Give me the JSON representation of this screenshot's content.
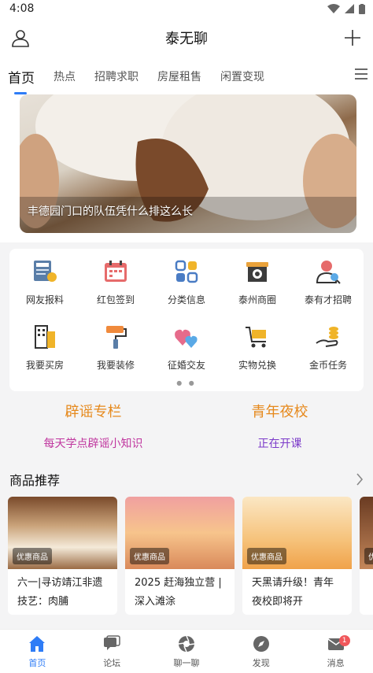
{
  "status": {
    "time": "4:08"
  },
  "header": {
    "title": "泰无聊"
  },
  "tabs": [
    {
      "label": "首页"
    },
    {
      "label": "热点"
    },
    {
      "label": "招聘求职"
    },
    {
      "label": "房屋租售"
    },
    {
      "label": "闲置变现"
    }
  ],
  "banner": {
    "caption": "丰德园门口的队伍凭什么排这么长"
  },
  "grid": [
    {
      "label": "网友报料",
      "icon": "news-icon"
    },
    {
      "label": "红包签到",
      "icon": "calendar-icon"
    },
    {
      "label": "分类信息",
      "icon": "category-grid-icon"
    },
    {
      "label": "泰州商圈",
      "icon": "shop-icon"
    },
    {
      "label": "泰有才招聘",
      "icon": "recruit-person-icon"
    },
    {
      "label": "我要买房",
      "icon": "building-icon"
    },
    {
      "label": "我要装修",
      "icon": "paint-roller-icon"
    },
    {
      "label": "征婚交友",
      "icon": "hearts-icon"
    },
    {
      "label": "实物兑换",
      "icon": "cart-icon"
    },
    {
      "label": "金币任务",
      "icon": "coin-hand-icon"
    }
  ],
  "promo": {
    "left": {
      "title": "辟谣专栏",
      "sub": "每天学点辟谣小知识"
    },
    "right": {
      "title": "青年夜校",
      "sub": "正在开课"
    }
  },
  "goods_section": {
    "title": "商品推荐"
  },
  "goods": [
    {
      "badge": "优惠商品",
      "name": "六一|寻访靖江非遗技艺：肉脯"
    },
    {
      "badge": "优惠商品",
      "name": "2025 赶海独立营 | 深入滩涂"
    },
    {
      "badge": "优惠商品",
      "name": "天黑请升级！青年夜校即将开"
    },
    {
      "badge": "优惠商品",
      "name": ""
    }
  ],
  "bottom_nav": [
    {
      "label": "首页"
    },
    {
      "label": "论坛"
    },
    {
      "label": "聊一聊"
    },
    {
      "label": "发现"
    },
    {
      "label": "消息",
      "badge": "1"
    }
  ],
  "colors": {
    "accent": "#2e7cf6",
    "promo_title": "#e6891c"
  }
}
